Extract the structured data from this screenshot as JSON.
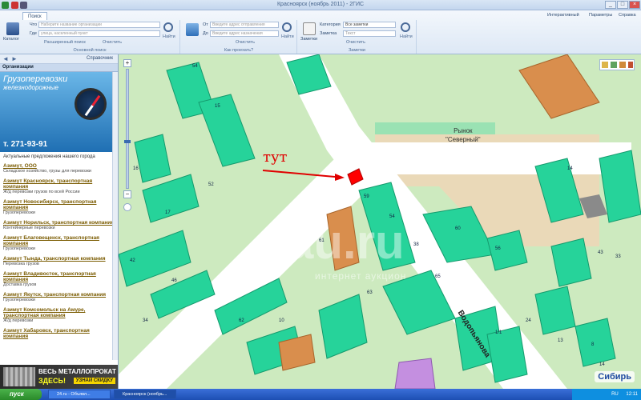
{
  "app": {
    "title": "Красноярск (ноябрь 2011) - 2ГИС",
    "ribbon_tab": "Поиск",
    "top_links": [
      "Интерактивный",
      "Параметры",
      "Справка"
    ]
  },
  "ribbon": {
    "basic_search": {
      "label": "Основной поиск",
      "catalog_label": "Каталог",
      "what_label": "Что",
      "what_placeholder": "Наберите название организации",
      "where_label": "Где",
      "where_placeholder": "улица, населенный пункт",
      "find_label": "Найти",
      "advanced": "Расширенный поиск",
      "clear": "Очистить"
    },
    "route": {
      "label": "Как проехать?",
      "from_label": "От",
      "from_placeholder": "Введите адрес отправления",
      "to_label": "До",
      "to_placeholder": "Введите адрес назначения",
      "find_label": "Найти",
      "clear": "Очистить"
    },
    "notes": {
      "label": "Заметки",
      "icon_label": "Заметки",
      "select_label": "Категория",
      "select_value": "Все заметки",
      "text_label": "Заметка",
      "text_placeholder": "Текст",
      "find_label": "Найти",
      "clear": "Очистить"
    }
  },
  "left_panel": {
    "nav_dropdown": "Справочник",
    "section_title": "Организации",
    "ad": {
      "title": "Грузоперевозки",
      "subtitle": "железнодорожные",
      "phone": "т. 271-93-91"
    },
    "tagline": "Актуальные предложения нашего города",
    "orgs": [
      {
        "name": "Азимут, ООО",
        "desc": "Складское хозяйство, грузы для перевозки"
      },
      {
        "name": "Азимут Красноярск, транспортная компания",
        "desc": "Ж/д перевозки грузов по всей России"
      },
      {
        "name": "Азимут Новосибирск, транспортная компания",
        "desc": "Грузоперевозки"
      },
      {
        "name": "Азимут Норильск, транспортная компания",
        "desc": "Контейнерные перевозки"
      },
      {
        "name": "Азимут Благовещенск, транспортная компания",
        "desc": "Грузоперевозки"
      },
      {
        "name": "Азимут Тында, транспортная компания",
        "desc": "Перевозка грузов"
      },
      {
        "name": "Азимут Владивосток, транспортная компания",
        "desc": "Доставка грузов"
      },
      {
        "name": "Азимут Якутск, транспортная компания",
        "desc": "Грузоперевозки"
      },
      {
        "name": "Азимут Комсомольск на Амуре, транспортная компания",
        "desc": "Ж/д перевозки"
      },
      {
        "name": "Азимут Хабаровск, транспортная компания",
        "desc": ""
      }
    ],
    "banner": {
      "line1": "ВЕСЬ МЕТАЛЛОПРОКАТ",
      "line2": "ЗДЕСЬ!",
      "button": "УЗНАЙ СКИДКУ"
    }
  },
  "map": {
    "market_line1": "Рынок",
    "market_line2": "\"Северный\"",
    "street": "Водопьянова",
    "annotation": "тут",
    "watermark": "au.ru",
    "watermark_sub": "интернет аукцион",
    "sponsor": "Сибирь",
    "house_numbers": [
      "54",
      "15",
      "16",
      "17",
      "42",
      "46",
      "62",
      "52",
      "59",
      "54",
      "61",
      "63",
      "38",
      "60",
      "65",
      "56",
      "14",
      "43",
      "1/1",
      "24",
      "13",
      "8",
      "33",
      "34",
      "10",
      "14"
    ]
  },
  "taskbar": {
    "start": "пуск",
    "tasks": [
      "24.ru - Объявл...",
      "Красноярск (ноябрь..."
    ],
    "lang": "RU",
    "time": "12:11"
  }
}
